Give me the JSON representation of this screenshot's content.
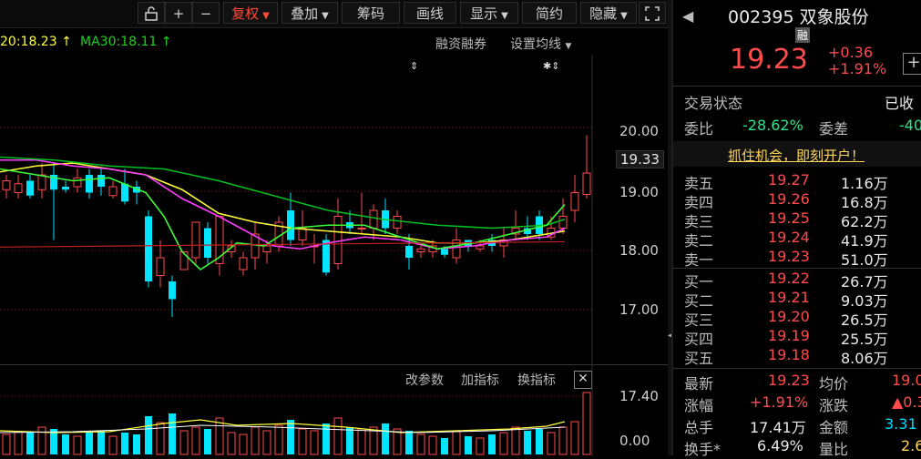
{
  "toolbar": {
    "lock_icon": "lock-icon",
    "zoom_in": "+",
    "zoom_out": "−",
    "fuquan": "复权",
    "diejia": "叠加",
    "chouma": "筹码",
    "huaxian": "画线",
    "xianshi": "显示",
    "jianyue": "简约",
    "yincang": "隐藏",
    "fullscreen_icon": "expand-icon"
  },
  "chart": {
    "ma20_label": "20:18.23",
    "ma30_label": "MA30:18.11",
    "rongzi": "融资融券",
    "set_ma": "设置均线",
    "y_ticks": [
      "20.00",
      "19.00",
      "18.00",
      "17.00"
    ],
    "current_price": "19.33"
  },
  "indicator": {
    "gai_canshu": "改参数",
    "jia_zhibiao": "加指标",
    "huan_zhibiao": "换指标",
    "y_top": "17.40",
    "y_bottom": "0.00"
  },
  "panel": {
    "code": "002395",
    "name": "双象股份",
    "rong_badge": "融",
    "price": "19.23",
    "change": "+0.36",
    "change_pct": "+1.91%",
    "trade_status_label": "交易状态",
    "trade_status_value": "已收",
    "weibi_label": "委比",
    "weibi_value": "-28.62%",
    "weicha_label": "委差",
    "weicha_value": "-40",
    "promo": "抓住机会，即刻开户！",
    "asks": [
      {
        "label": "卖五",
        "price": "19.27",
        "vol": "1.16万"
      },
      {
        "label": "卖四",
        "price": "19.26",
        "vol": "16.8万"
      },
      {
        "label": "卖三",
        "price": "19.25",
        "vol": "62.2万"
      },
      {
        "label": "卖二",
        "price": "19.24",
        "vol": "41.9万"
      },
      {
        "label": "卖一",
        "price": "19.23",
        "vol": "51.0万"
      }
    ],
    "bids": [
      {
        "label": "买一",
        "price": "19.22",
        "vol": "26.7万"
      },
      {
        "label": "买二",
        "price": "19.21",
        "vol": "9.03万"
      },
      {
        "label": "买三",
        "price": "19.20",
        "vol": "26.5万"
      },
      {
        "label": "买四",
        "price": "19.19",
        "vol": "25.5万"
      },
      {
        "label": "买五",
        "price": "19.18",
        "vol": "8.06万"
      }
    ],
    "stats": {
      "zuixin_label": "最新",
      "zuixin_value": "19.23",
      "junjia_label": "均价",
      "junjia_value": "19.0",
      "zhangfu_label": "涨幅",
      "zhangfu_value": "+1.91%",
      "zhangdie_label": "涨跌",
      "zhangdie_value": "▲0.3",
      "zongshou_label": "总手",
      "zongshou_value": "17.41万",
      "jine_label": "金额",
      "jine_value": "3.31",
      "huanshou_label": "换手*",
      "huanshou_value": "6.49%",
      "liangbi_label": "量比",
      "liangbi_value": "2.6"
    }
  },
  "colors": {
    "up": "#ff4b4b",
    "down": "#00e5ff",
    "ma5": "#ffffff",
    "ma10": "#ffff3c",
    "ma20": "#ff3cff",
    "ma30": "#00c020",
    "ma60": "#3cff3c",
    "grid": "#5a1010"
  }
}
